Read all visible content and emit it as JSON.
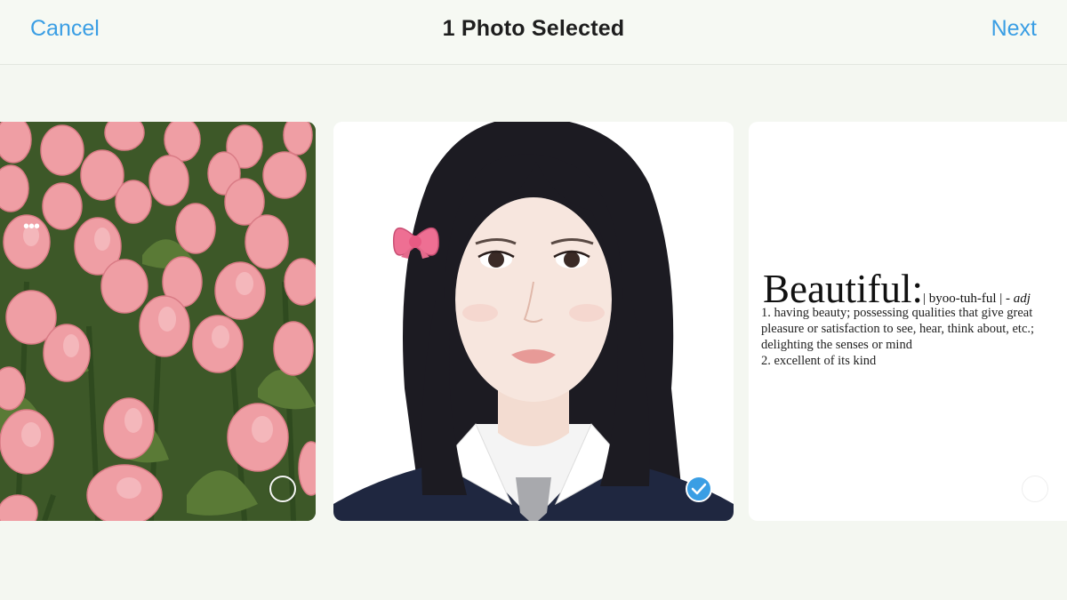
{
  "header": {
    "cancel_label": "Cancel",
    "title": "1 Photo Selected",
    "next_label": "Next"
  },
  "photos": [
    {
      "subject": "pink tulips",
      "selected": false,
      "more_indicator": "•••"
    },
    {
      "subject": "portrait of a girl with pink bow in school uniform",
      "selected": true
    },
    {
      "subject": "dictionary definition",
      "selected": false,
      "word": "Beautiful:",
      "pronunciation": "| byoo-tuh-ful | - ",
      "part_of_speech": "adj",
      "def_1a": "1. having beauty; possessing qualities that give great",
      "def_1b": "pleasure or satisfaction to see, hear, think about, etc.;",
      "def_1c": "delighting the senses or mind",
      "def_2": "2. excellent of its kind"
    }
  ],
  "colors": {
    "accent": "#3a9ee4",
    "background": "#f4f7f1"
  }
}
